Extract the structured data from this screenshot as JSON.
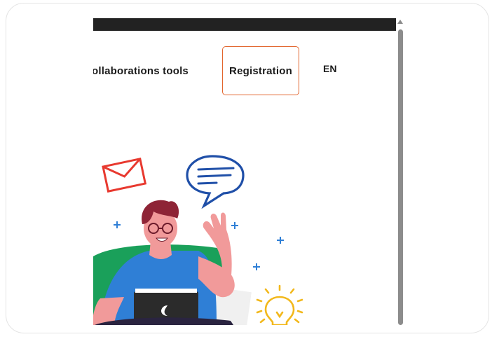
{
  "nav": {
    "collab_label": "ollaborations tools",
    "registration_label": "Registration",
    "language_label": "EN"
  },
  "illustration": {
    "description_icons": [
      "envelope-icon",
      "speech-bubble-icon",
      "lightbulb-icon",
      "laptop-icon",
      "plus-sparkle-icon"
    ]
  },
  "colors": {
    "accent_border": "#e2662e",
    "topbar": "#222222",
    "envelope": "#e8392f",
    "bubble": "#1f4fa8",
    "shirt": "#2f7fd6",
    "chair": "#1aa05a",
    "bulb": "#f2b81c"
  }
}
